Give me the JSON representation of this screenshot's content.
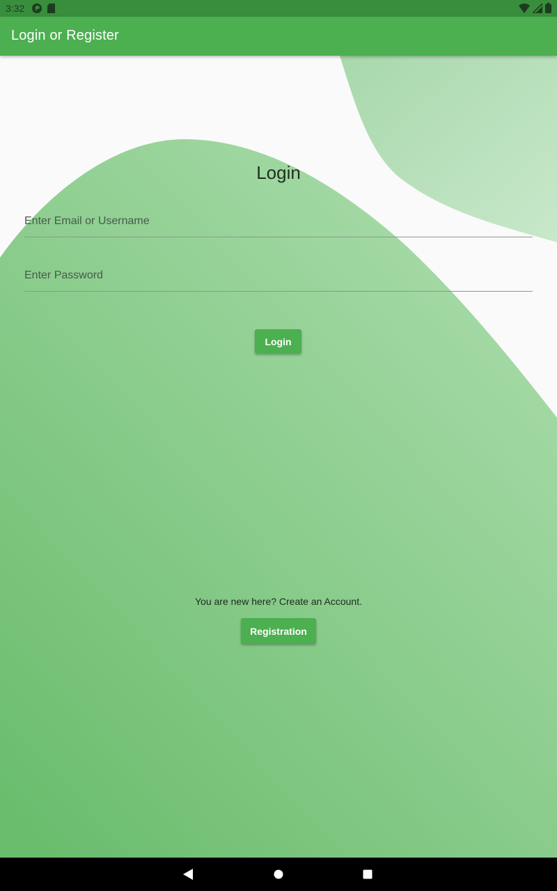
{
  "status_bar": {
    "time": "3:32",
    "left_icons": [
      "app-notification-icon",
      "sd-card-icon"
    ],
    "right_icons": [
      "wifi-icon",
      "cell-signal-icon",
      "battery-icon"
    ]
  },
  "app_bar": {
    "title": "Login or Register"
  },
  "login_form": {
    "heading": "Login",
    "email_placeholder": "Enter Email or Username",
    "email_value": "",
    "password_placeholder": "Enter Password",
    "password_value": "",
    "login_button_label": "Login"
  },
  "register_section": {
    "prompt": "You are new here? Create an Account.",
    "button_label": "Registration"
  },
  "nav_bar": {
    "buttons": [
      "back-icon",
      "home-icon",
      "recents-icon"
    ]
  },
  "colors": {
    "primary": "#4caf50",
    "primary_dark": "#388e3c",
    "background": "#fafafa",
    "wave_light": "#c5e6c7",
    "wave_main": "#81c784"
  }
}
